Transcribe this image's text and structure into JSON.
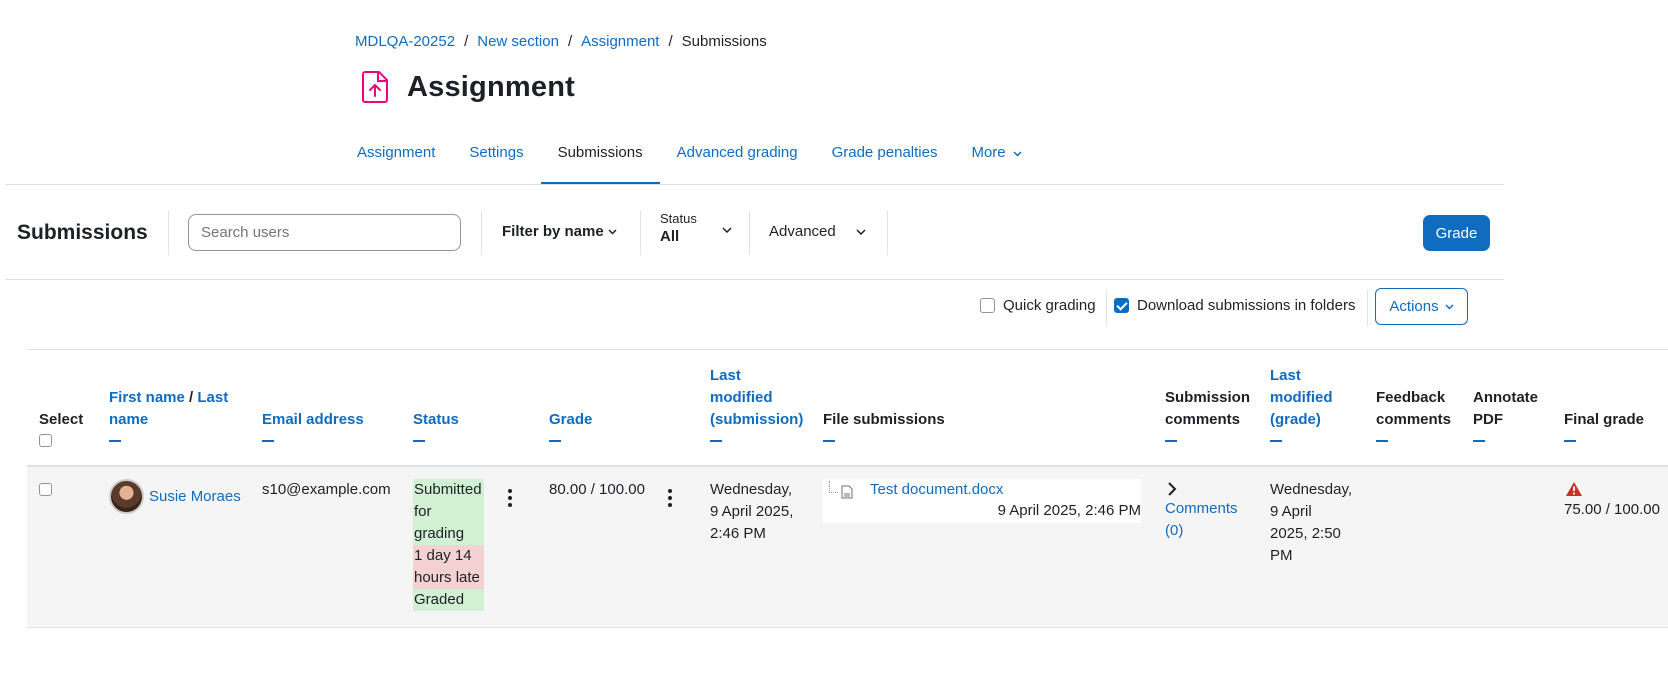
{
  "breadcrumb": {
    "items": [
      "MDLQA-20252",
      "New section",
      "Assignment"
    ],
    "current": "Submissions"
  },
  "page": {
    "title": "Assignment",
    "icon": "assignment-upload-icon",
    "accent": "#e7087b"
  },
  "nav": {
    "tabs": [
      "Assignment",
      "Settings",
      "Submissions",
      "Advanced grading",
      "Grade penalties"
    ],
    "more": "More",
    "active": "Submissions"
  },
  "toolbar": {
    "title": "Submissions",
    "search_placeholder": "Search users",
    "filter_by_name": "Filter by name",
    "status_label": "Status",
    "status_value": "All",
    "advanced": "Advanced",
    "grade_button": "Grade"
  },
  "options": {
    "quick_grading": "Quick grading",
    "quick_grading_checked": false,
    "download_folders": "Download submissions in folders",
    "download_folders_checked": true,
    "actions": "Actions"
  },
  "table": {
    "headers": {
      "select": "Select",
      "first_name": "First name",
      "slash": "/",
      "last_name_1": "Last",
      "last_name_2": "name",
      "email": "Email address",
      "status": "Status",
      "grade": "Grade",
      "last_modified_sub": [
        "Last",
        "modified",
        "(submission)"
      ],
      "file_submissions": "File submissions",
      "submission_comments": [
        "Submission",
        "comments"
      ],
      "last_modified_grade": [
        "Last",
        "modified",
        "(grade)"
      ],
      "feedback_comments": [
        "Feedback",
        "comments"
      ],
      "annotate_pdf": [
        "Annotate",
        "PDF"
      ],
      "final_grade": "Final grade"
    },
    "rows": [
      {
        "name": "Susie Moraes",
        "email": "s10@example.com",
        "status_submitted": [
          "Submitted",
          "for",
          "grading"
        ],
        "status_late": [
          "1 day 14",
          "hours late"
        ],
        "status_graded": "Graded",
        "grade": "80.00 / 100.00",
        "last_modified_sub": [
          "Wednesday,",
          "9 April 2025,",
          "2:46 PM"
        ],
        "file_name": "Test document.docx",
        "file_date": "9 April 2025, 2:46 PM",
        "comments": [
          "Comments",
          "(0)"
        ],
        "last_modified_grade": [
          "Wednesday,",
          "9 April",
          "2025, 2:50",
          "PM"
        ],
        "final_grade": "75.00 / 100.00"
      }
    ]
  }
}
